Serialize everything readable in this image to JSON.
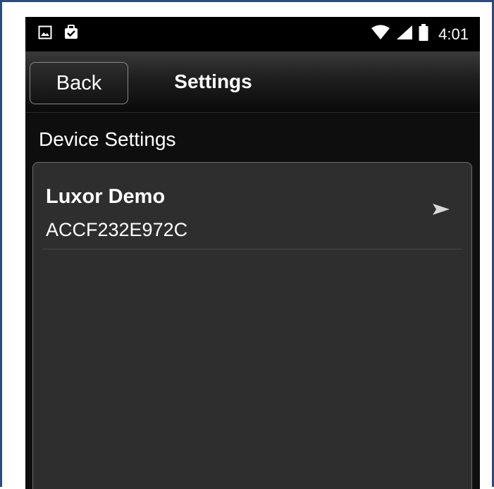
{
  "status_bar": {
    "time": "4:01",
    "icons": [
      "image-icon",
      "clipboard-check-icon",
      "wifi-icon",
      "signal-icon",
      "battery-icon"
    ]
  },
  "header": {
    "back_label": "Back",
    "title": "Settings"
  },
  "section": {
    "title": "Device Settings"
  },
  "devices": [
    {
      "name": "Luxor Demo",
      "id": "ACCF232E972C",
      "chevron_icon": "play-arrow-icon"
    }
  ],
  "colors": {
    "frame_border": "#2d4a7c",
    "panel_bg": "#2e2e2e",
    "text": "#ffffff"
  }
}
